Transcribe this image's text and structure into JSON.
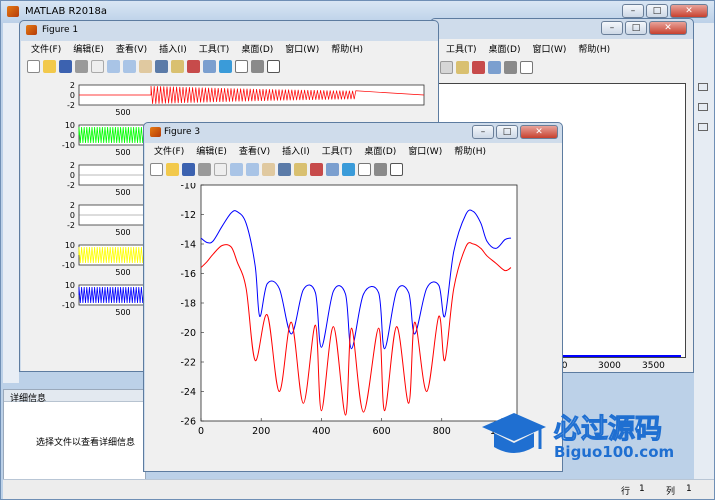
{
  "matlab": {
    "title": "MATLAB R2018a",
    "menu": [
      "工具(T)",
      "桌面(D)",
      "窗口(W)",
      "帮助(H)"
    ],
    "status_row_label": "行",
    "status_row_value": "1",
    "status_col_label": "列",
    "status_col_value": "1",
    "details_title": "详细信息",
    "details_text": "选择文件以查看详细信息",
    "fig_right_xticks": [
      "3000",
      "3500"
    ],
    "fig_right_xtick_partial": "00"
  },
  "figure1": {
    "title": "Figure 1",
    "menu": [
      "文件(F)",
      "编辑(E)",
      "查看(V)",
      "插入(I)",
      "工具(T)",
      "桌面(D)",
      "窗口(W)",
      "帮助(H)"
    ],
    "subplots": [
      {
        "yticks": [
          "2",
          "0",
          "-2"
        ],
        "xtick": "500",
        "color": "#ff0000"
      },
      {
        "yticks": [
          "10",
          "0",
          "-10"
        ],
        "xtick": "500",
        "color": "#00ff00"
      },
      {
        "yticks": [
          "2",
          "0",
          "-2"
        ],
        "xtick": "500",
        "color": "#000000"
      },
      {
        "yticks": [
          "2",
          "0",
          "-2"
        ],
        "xtick": "500",
        "color": "#000000"
      },
      {
        "yticks": [
          "10",
          "0",
          "-10"
        ],
        "xtick": "500",
        "color": "#ffff00"
      },
      {
        "yticks": [
          "10",
          "0",
          "-10"
        ],
        "xtick": "500",
        "color": "#0000ff"
      }
    ]
  },
  "figure3": {
    "title": "Figure 3",
    "menu": [
      "文件(F)",
      "编辑(E)",
      "查看(V)",
      "插入(I)",
      "工具(T)",
      "桌面(D)",
      "窗口(W)",
      "帮助(H)"
    ]
  },
  "watermark": {
    "brand": "必过源码",
    "url": "Biguo100.com"
  },
  "chart_data": {
    "type": "line",
    "title": "",
    "xlabel": "",
    "ylabel": "",
    "xlim": [
      0,
      1050
    ],
    "ylim": [
      -26,
      -10
    ],
    "xticks": [
      0,
      200,
      400,
      600,
      800,
      1000
    ],
    "yticks": [
      -10,
      -12,
      -14,
      -16,
      -18,
      -20,
      -22,
      -24,
      -26
    ],
    "series": [
      {
        "color": "#0000ff",
        "x": [
          0,
          20,
          40,
          70,
          100,
          120,
          150,
          180,
          195,
          220,
          260,
          300,
          340,
          380,
          400,
          440,
          480,
          500,
          540,
          590,
          610,
          650,
          690,
          710,
          750,
          790,
          810,
          840,
          880,
          905,
          930,
          950,
          980,
          1010,
          1030
        ],
        "y": [
          -13.6,
          -13.9,
          -13.8,
          -12.8,
          -11.9,
          -11.8,
          -12.6,
          -15.5,
          -18.9,
          -16.7,
          -17,
          -20.1,
          -17.1,
          -17.3,
          -21.0,
          -17.2,
          -17.4,
          -21.1,
          -17.4,
          -17.3,
          -21.1,
          -17.2,
          -17.3,
          -20.1,
          -17.0,
          -16.8,
          -18.9,
          -14.5,
          -12.0,
          -11.8,
          -12.6,
          -13.8,
          -14.3,
          -13.7,
          -13.6
        ]
      },
      {
        "color": "#ff0000",
        "x": [
          0,
          20,
          40,
          70,
          100,
          120,
          150,
          180,
          220,
          260,
          300,
          340,
          380,
          400,
          440,
          480,
          500,
          540,
          590,
          610,
          650,
          690,
          710,
          750,
          790,
          810,
          840,
          880,
          905,
          930,
          950,
          980,
          1010,
          1030
        ],
        "y": [
          -15.6,
          -15.2,
          -14.7,
          -14.1,
          -14.2,
          -15.2,
          -17.0,
          -21.9,
          -18.8,
          -24.0,
          -19.3,
          -24.8,
          -19.5,
          -25.3,
          -19.6,
          -25.6,
          -19.7,
          -25.4,
          -19.7,
          -25.3,
          -19.6,
          -24.8,
          -19.3,
          -24.0,
          -18.9,
          -21.9,
          -17.0,
          -14.2,
          -14.0,
          -14.3,
          -14.8,
          -15.3,
          -15.8,
          -15.6
        ]
      }
    ]
  }
}
